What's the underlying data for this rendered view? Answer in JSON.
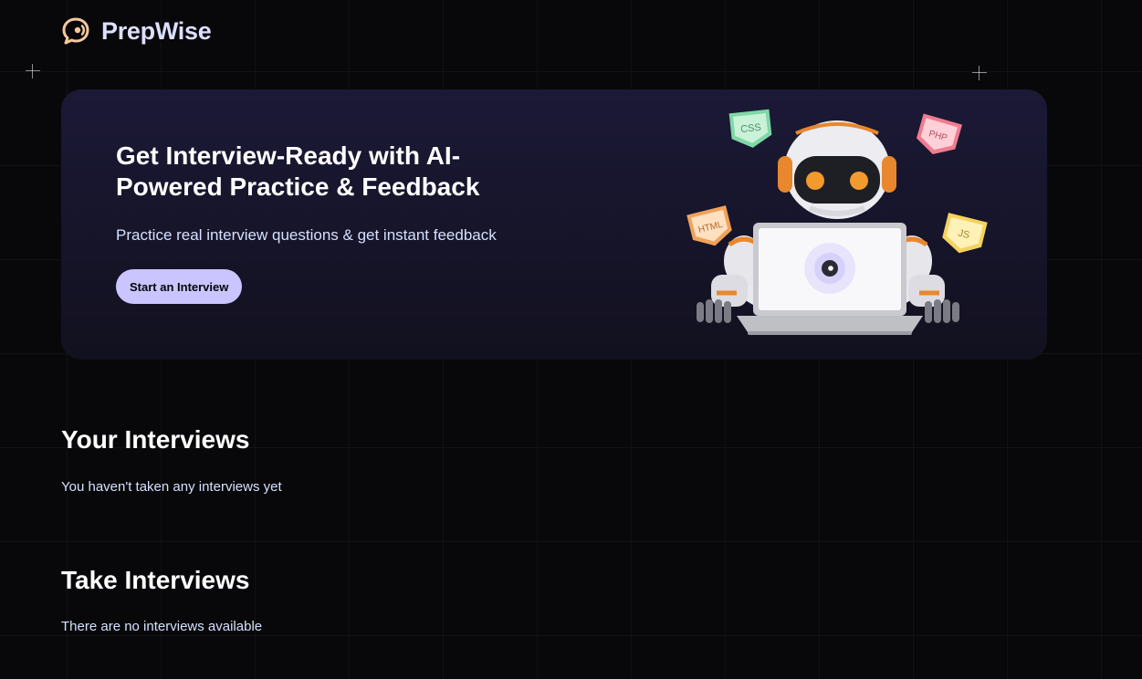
{
  "brand": {
    "name": "PrepWise",
    "icon": "chat-bubble-logo-icon"
  },
  "hero": {
    "title": "Get Interview-Ready with AI-Powered Practice & Feedback",
    "subtitle": "Practice real interview questions & get instant feedback",
    "cta_label": "Start an Interview",
    "illustration": {
      "icon": "robot-with-laptop-illustration",
      "badges": [
        "CSS",
        "PHP",
        "HTML",
        "JS"
      ]
    }
  },
  "your_interviews": {
    "title": "Your Interviews",
    "empty_text": "You haven't taken any interviews yet"
  },
  "take_interviews": {
    "title": "Take Interviews",
    "empty_text": "There are no interviews available"
  },
  "colors": {
    "background": "#08080a",
    "primary_button": "#cac5fe",
    "brand_text": "#dddfff",
    "hero_gradient_top": "#1b1936",
    "hero_gradient_bottom": "#12111f",
    "light_text": "#d6e0ff"
  }
}
